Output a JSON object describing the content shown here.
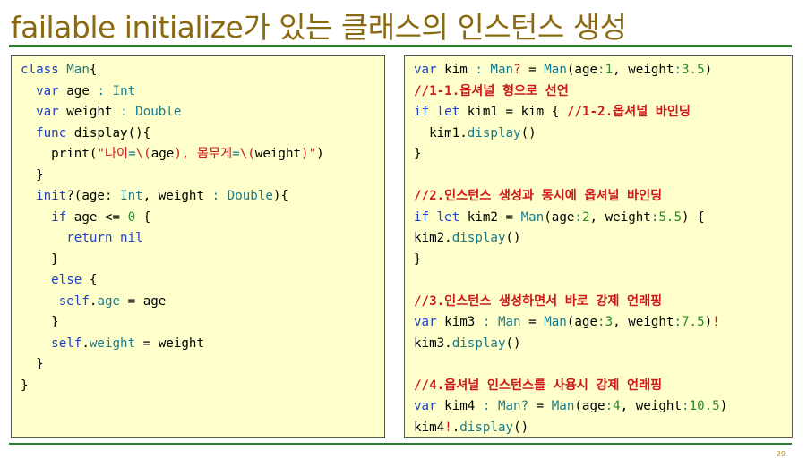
{
  "slide": {
    "title": "failable initialize가 있는 클래스의 인스턴스 생성",
    "page_number": "29"
  },
  "left_code": {
    "l1": {
      "kw": "class",
      "sp": " ",
      "name": "Man",
      "brace": "{"
    },
    "l2": {
      "kw": "var",
      "name": " age ",
      "colon": ":",
      "type": " Int"
    },
    "l3": {
      "kw": "var",
      "name": " weight ",
      "colon": ":",
      "type": " Double"
    },
    "l4": {
      "kw": "func",
      "rest": " display(){"
    },
    "l5": {
      "fn": "print(",
      "s1": "\"나이",
      "eq1": "=",
      "s2": "\\(",
      "v1": "age",
      "s3": "), 몸무게",
      "eq2": "=",
      "s4": "\\(",
      "v2": "weight",
      "s5": ")\"",
      "close": ")"
    },
    "l6": {
      "text": "}"
    },
    "l7": {
      "kw": "init",
      "q": "?(age: ",
      "t1": "Int",
      "mid": ", weight ",
      "c": ":",
      "t2": " Double",
      "end": "){"
    },
    "l8": {
      "kw": "if",
      "mid": " age <= ",
      "num": "0",
      "end": " {"
    },
    "l9": {
      "kw": "return",
      "sp": " ",
      "nil": "nil"
    },
    "l10": {
      "text": "}"
    },
    "l11": {
      "kw": "else",
      "end": " {"
    },
    "l12": {
      "self": "self",
      "dot": ".",
      "prop": "age",
      "eq": " = ",
      "val": "age"
    },
    "l13": {
      "text": "}"
    },
    "l14": {
      "self": "self",
      "dot": ".",
      "prop": "weight",
      "eq": " = ",
      "val": "weight"
    },
    "l15": {
      "text": "}"
    },
    "l16": {
      "text": "}"
    }
  },
  "right_code": {
    "r1": {
      "kw": "var",
      "a": " kim ",
      "c": ":",
      "t": " Man",
      "q": "?",
      "eq": " = ",
      "t2": "Man",
      "p1": "(age",
      "c2": ":",
      "n1": "1",
      "p2": ", weight",
      "c3": ":",
      "n2": "3.5",
      "end": ")"
    },
    "r2": {
      "comment": "//1-1.옵셔널 형으로 선언"
    },
    "r3": {
      "kw1": "if",
      "kw2": " let",
      "a": " kim1 = kim { ",
      "comment": "//1-2.옵셔널 바인딩"
    },
    "r4": {
      "a": "  kim1.",
      "fn": "display",
      "b": "()"
    },
    "r5": {
      "text": "}"
    },
    "r6": {
      "text": ""
    },
    "r7": {
      "comment": "//2.인스턴스 생성과 동시에 옵셔널 바인딩"
    },
    "r8": {
      "kw1": "if",
      "kw2": " let",
      "a": " kim2 = ",
      "t": "Man",
      "p1": "(age",
      "c1": ":",
      "n1": "2",
      "p2": ", weight",
      "c2": ":",
      "n2": "5.5",
      "end": ") {"
    },
    "r9": {
      "a": "kim2.",
      "fn": "display",
      "b": "()"
    },
    "r10": {
      "text": "}"
    },
    "r11": {
      "text": ""
    },
    "r12": {
      "comment": "//3.인스턴스 생성하면서 바로 강제 언래핑"
    },
    "r13": {
      "kw": "var",
      "a": " kim3 ",
      "c": ":",
      "t": " Man",
      "eq": " = ",
      "t2": "Man",
      "p1": "(age",
      "c2": ":",
      "n1": "3",
      "p2": ", weight",
      "c3": ":",
      "n2": "7.5",
      "end": ")",
      "bang": "!"
    },
    "r14": {
      "a": "kim3.",
      "fn": "display",
      "b": "()"
    },
    "r15": {
      "text": ""
    },
    "r16": {
      "comment": "//4.옵셔널 인스턴스를 사용시 강제 언래핑"
    },
    "r17": {
      "kw": "var",
      "a": " kim4 ",
      "c": ":",
      "t": " Man",
      "q": "?",
      "eq": " = ",
      "t2": "Man",
      "p1": "(age",
      "c2": ":",
      "n1": "4",
      "p2": ", weight",
      "c3": ":",
      "n2": "10.5",
      "end": ")"
    },
    "r18": {
      "a": "kim4",
      "bang": "!",
      "dot": ".",
      "fn": "display",
      "b": "()"
    }
  }
}
